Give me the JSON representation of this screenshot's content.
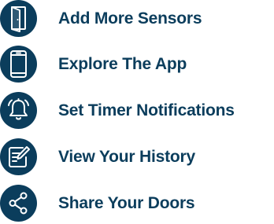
{
  "colors": {
    "accent": "#0b3d5c",
    "icon_stroke": "#ffffff",
    "background": "#ffffff"
  },
  "menu": {
    "items": [
      {
        "label": "Add More Sensors",
        "icon": "door-sensor-icon"
      },
      {
        "label": "Explore The App",
        "icon": "phone-icon"
      },
      {
        "label": "Set Timer Notifications",
        "icon": "bell-icon"
      },
      {
        "label": "View Your History",
        "icon": "notepad-pencil-icon"
      },
      {
        "label": "Share Your Doors",
        "icon": "share-icon"
      }
    ]
  }
}
